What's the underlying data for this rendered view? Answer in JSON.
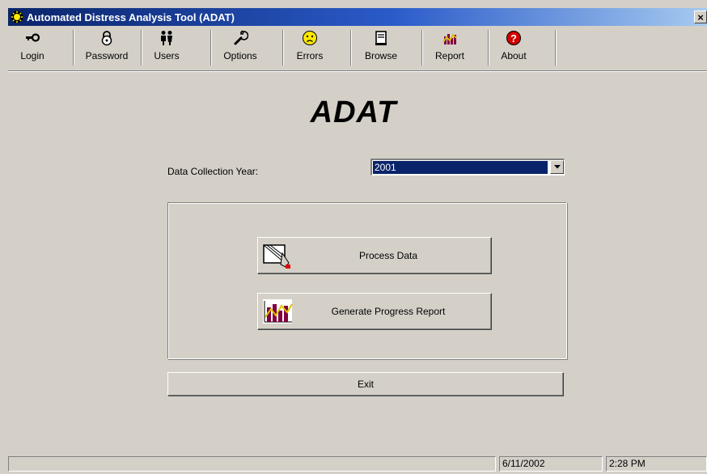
{
  "window": {
    "title": "Automated Distress Analysis Tool (ADAT)",
    "close_label": "×"
  },
  "toolbar": {
    "items": [
      {
        "label": "Login",
        "icon": "key-icon"
      },
      {
        "label": "Password",
        "icon": "padlock-icon"
      },
      {
        "label": "Users",
        "icon": "users-icon"
      },
      {
        "label": "Options",
        "icon": "wrench-icon"
      },
      {
        "label": "Errors",
        "icon": "sad-face-icon"
      },
      {
        "label": "Browse",
        "icon": "document-icon"
      },
      {
        "label": "Report",
        "icon": "report-chart-icon"
      },
      {
        "label": "About",
        "icon": "help-icon"
      }
    ]
  },
  "main": {
    "headline": "ADAT",
    "year_label": "Data Collection Year:",
    "year_value": "2001",
    "process_button": "Process Data",
    "report_button": "Generate Progress Report",
    "exit_button": "Exit"
  },
  "status": {
    "message": "",
    "date": "6/11/2002",
    "time": "2:28 PM"
  },
  "colors": {
    "titlebar_start": "#0a246a",
    "titlebar_end": "#a6caf0",
    "face": "#d4d0c8",
    "selection": "#0a246a"
  }
}
